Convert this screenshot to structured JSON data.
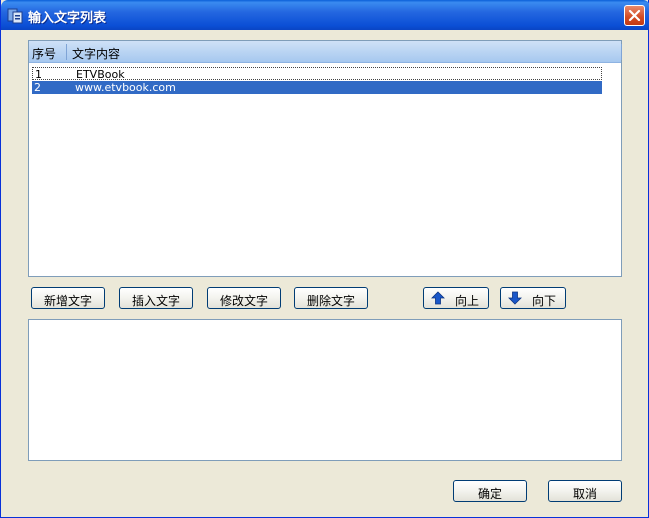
{
  "window": {
    "title": "输入文字列表"
  },
  "list": {
    "columns": [
      "序号",
      "文字内容"
    ],
    "rows": [
      {
        "num": "1",
        "text": "ETVBook"
      },
      {
        "num": "2",
        "text": "www.etvbook.com"
      }
    ],
    "selected_row": 2
  },
  "buttons": {
    "add": "新增文字",
    "insert": "插入文字",
    "modify": "修改文字",
    "delete": "删除文字",
    "up": "向上",
    "down": "向下",
    "ok": "确定",
    "cancel": "取消"
  },
  "editor": {
    "value": ""
  },
  "icons": {
    "app": "app-icon",
    "close": "close-icon",
    "up": "arrow-up-icon",
    "down": "arrow-down-icon"
  },
  "colors": {
    "titlebar": "#0a5fd8",
    "selection": "#316ac5",
    "window_bg": "#ece9d8"
  }
}
